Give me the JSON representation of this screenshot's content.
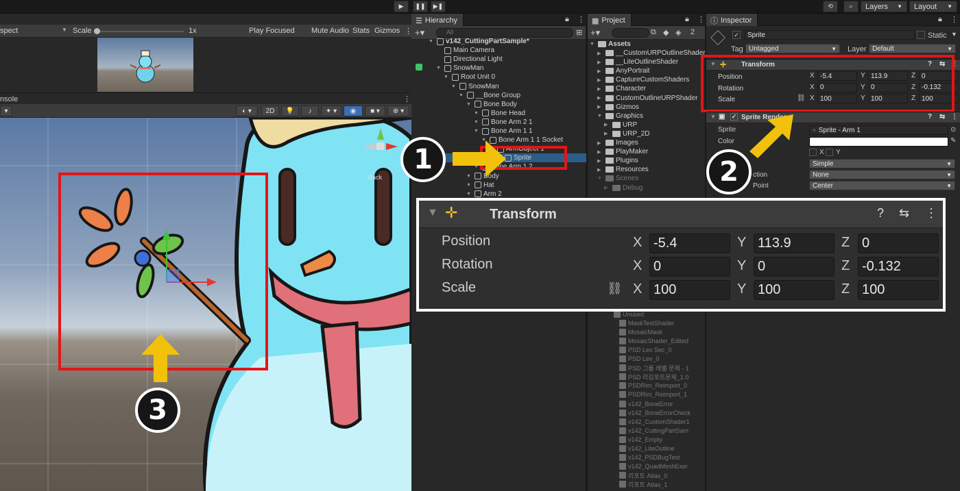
{
  "toolbar": {
    "layers": "Layers",
    "layout": "Layout",
    "play_icon": "▶",
    "pause_icon": "❚❚",
    "step_icon": "▶❚"
  },
  "game": {
    "aspect": "spect",
    "scale_label": "Scale",
    "scale_value": "1x",
    "play_focused": "Play Focused",
    "mute": "Mute Audio",
    "stats": "Stats",
    "gizmos": "Gizmos"
  },
  "console": {
    "label": "nsole"
  },
  "scene": {
    "mode_2d": "2D",
    "back_label": "Back"
  },
  "hierarchy": {
    "tab": "Hierarchy",
    "search": "All",
    "rows": [
      {
        "label": "v142_CuttingPartSample*",
        "indent": 0,
        "bold": true
      },
      {
        "label": "Main Camera",
        "indent": 1
      },
      {
        "label": "Directional Light",
        "indent": 1
      },
      {
        "label": "SnowMan",
        "indent": 1
      },
      {
        "label": "Root Unit 0",
        "indent": 2
      },
      {
        "label": "SnowMan",
        "indent": 3
      },
      {
        "label": "__Bone Group",
        "indent": 4
      },
      {
        "label": "Bone Body",
        "indent": 5
      },
      {
        "label": "Bone Head",
        "indent": 6
      },
      {
        "label": "Bone Arm 2 1",
        "indent": 6
      },
      {
        "label": "Bone Arm 1 1",
        "indent": 6
      },
      {
        "label": "Bone Arm 1 1 Socket",
        "indent": 7
      },
      {
        "label": "ArmObject 1",
        "indent": 8
      },
      {
        "label": "Sprite",
        "indent": 9,
        "selected": true
      },
      {
        "label": "Bone Arm 1 2",
        "indent": 6
      },
      {
        "label": "Body",
        "indent": 5
      },
      {
        "label": "Hat",
        "indent": 5
      },
      {
        "label": "Arm 2",
        "indent": 5
      }
    ]
  },
  "project": {
    "tab": "Project",
    "count": "2",
    "assets_label": "Assets",
    "folders": [
      "__CustomURPOutlineShader",
      "__LiteOutlineShader",
      "AnyPortrait",
      "CaptureCustomShaders",
      "Character",
      "CustomOutlineURPShader",
      "Gizmos",
      "Graphics",
      "URP",
      "URP_2D",
      "Images",
      "PlayMaker",
      "Plugins",
      "Resources",
      "Scenes",
      "Debug"
    ],
    "files": [
      "Unused",
      "MaskTestShader",
      "MosaicMask",
      "MosaicShader_Edited",
      "PSD Lev Sec_0",
      "PSD Lev_0",
      "PSD 그룹 레벨 문제 - 1",
      "PSD 리깅포트문제_1.0",
      "PSDRim_Reimport_0",
      "PSDRim_Reimport_1",
      "v142_BoneError",
      "v142_BoneErrorCheck",
      "v142_CustomShader1",
      "v142_CuttingPartSam",
      "v142_Empty",
      "v142_LiteOutline",
      "v142_PSDBugTest",
      "v142_QuadMeshExer",
      "리포트 Atlas_0",
      "리포트 Atlas_1"
    ]
  },
  "inspector": {
    "tab": "Inspector",
    "object_name": "Sprite",
    "static_label": "Static",
    "tag_label": "Tag",
    "tag_value": "Untagged",
    "layer_label": "Layer",
    "layer_value": "Default",
    "transform": {
      "title": "Transform",
      "position_label": "Position",
      "rotation_label": "Rotation",
      "scale_label": "Scale",
      "position": {
        "x": "-5.4",
        "y": "113.9",
        "z": "0"
      },
      "rotation": {
        "x": "0",
        "y": "0",
        "z": "-0.132"
      },
      "scale": {
        "x": "100",
        "y": "100",
        "z": "100"
      }
    },
    "sprite_renderer": {
      "title": "Sprite Renderer",
      "sprite_label": "Sprite",
      "sprite_value": "Sprite - Arm 1",
      "color_label": "Color",
      "flip_x": "X",
      "flip_y": "Y",
      "draw_mode": "Simple",
      "mask_label": "ction",
      "mask_value": "None",
      "pivot_label": "Point",
      "pivot_value": "Center"
    }
  },
  "axes": {
    "x": "X",
    "y": "Y",
    "z": "Z"
  },
  "badges": {
    "one": "1",
    "two": "2",
    "three": "3"
  },
  "colors": {
    "highlight": "#e21616",
    "arrow": "#f2c10c",
    "selected_row": "#2c5d87"
  }
}
